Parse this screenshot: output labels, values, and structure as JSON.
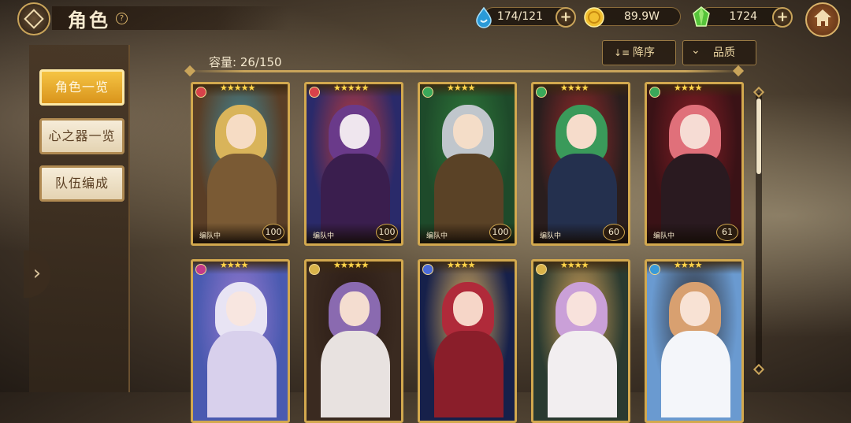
{
  "header": {
    "title": "角色",
    "help_symbol": "?",
    "stamina": "174/121",
    "gold": "89.9W",
    "gems": "1724",
    "plus_symbol": "+"
  },
  "sidebar": {
    "items": [
      {
        "label": "角色一览",
        "active": true
      },
      {
        "label": "心之器一览",
        "active": false
      },
      {
        "label": "队伍编成",
        "active": false
      }
    ],
    "expand_symbol": "›"
  },
  "toolbar": {
    "capacity": "容量: 26/150",
    "sort_label": "降序",
    "sort_icon": "↓≡",
    "filter_label": "品质",
    "filter_icon": "⌄"
  },
  "cards": [
    {
      "stars": "★★★★★",
      "team": "编队中",
      "level": "100",
      "element_color": "#d8424a",
      "palette": {
        "bg": "#5a3e26",
        "hair": "#d9b45a",
        "face": "#f6dcc4",
        "body": "#7a5a34",
        "accent": "#3e8a9c"
      }
    },
    {
      "stars": "★★★★★",
      "team": "编队中",
      "level": "100",
      "element_color": "#d8424a",
      "palette": {
        "bg": "#2a2a6a",
        "hair": "#6a3a8a",
        "face": "#efe6ee",
        "body": "#3a1e4e",
        "accent": "#c23a3a"
      }
    },
    {
      "stars": "★★★★",
      "team": "编队中",
      "level": "100",
      "element_color": "#3aa85a",
      "palette": {
        "bg": "#1e4a2a",
        "hair": "#c0c6cc",
        "face": "#f4ddc8",
        "body": "#5a4226",
        "accent": "#2f7a3a"
      }
    },
    {
      "stars": "★★★★",
      "team": "编队中",
      "level": "60",
      "element_color": "#3aa85a",
      "palette": {
        "bg": "#2a1e1e",
        "hair": "#3a9a5a",
        "face": "#f6dccb",
        "body": "#24304e",
        "accent": "#9a2a2a"
      }
    },
    {
      "stars": "★★★★",
      "team": "编队中",
      "level": "61",
      "element_color": "#3aa85a",
      "palette": {
        "bg": "#3a1216",
        "hair": "#e0707a",
        "face": "#f6dcd4",
        "body": "#2a1a20",
        "accent": "#8a1e26"
      }
    },
    {
      "stars": "★★★★",
      "team": "",
      "level": "",
      "element_color": "#c23a8a",
      "palette": {
        "bg": "#4a5ab0",
        "hair": "#e8e4f4",
        "face": "#f8e6e0",
        "body": "#d8d0ec",
        "accent": "#9a7ad0"
      }
    },
    {
      "stars": "★★★★★",
      "team": "",
      "level": "",
      "element_color": "#d9b34a",
      "palette": {
        "bg": "#3a2a20",
        "hair": "#8a6ab0",
        "face": "#f4ddd0",
        "body": "#e8e2e0",
        "accent": "#2a1a14"
      }
    },
    {
      "stars": "★★★★",
      "team": "",
      "level": "",
      "element_color": "#4a6ad8",
      "palette": {
        "bg": "#16204a",
        "hair": "#b02a3a",
        "face": "#f6d6c8",
        "body": "#8a1e2a",
        "accent": "#e0b25a"
      }
    },
    {
      "stars": "★★★★",
      "team": "",
      "level": "",
      "element_color": "#d9b34a",
      "palette": {
        "bg": "#2a3a30",
        "hair": "#caa0d8",
        "face": "#f8e2dc",
        "body": "#f2eef0",
        "accent": "#d8a45a"
      }
    },
    {
      "stars": "★★★★",
      "team": "",
      "level": "",
      "element_color": "#3a9ad8",
      "palette": {
        "bg": "#6a9ad0",
        "hair": "#d8a070",
        "face": "#f8e2d4",
        "body": "#f4f6fa",
        "accent": "#2a2a30"
      }
    }
  ]
}
